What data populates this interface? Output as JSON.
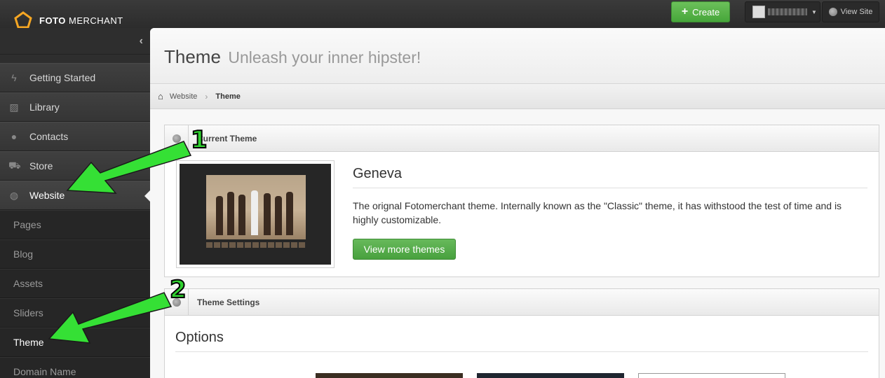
{
  "app": {
    "brand_bold": "FOTO",
    "brand_rest": " MERCHANT",
    "accent": "#f5a623"
  },
  "topbar": {
    "create_label": "Create",
    "view_site_label": "View Site"
  },
  "sidebar": {
    "items": [
      {
        "label": "Getting Started",
        "icon": "bolt-icon"
      },
      {
        "label": "Library",
        "icon": "image-icon"
      },
      {
        "label": "Contacts",
        "icon": "user-icon"
      },
      {
        "label": "Store",
        "icon": "cart-icon"
      },
      {
        "label": "Website",
        "icon": "globe-icon"
      }
    ],
    "sub_items": [
      "Pages",
      "Blog",
      "Assets",
      "Sliders",
      "Theme",
      "Domain Name"
    ]
  },
  "header": {
    "title": "Theme",
    "subtitle": "Unleash your inner hipster!"
  },
  "breadcrumb": {
    "items": [
      "Website",
      "Theme"
    ]
  },
  "current_theme": {
    "panel_title": "Current Theme",
    "name": "Geneva",
    "description": "The orignal Fotomerchant theme. Internally known as the \"Classic\" theme, it has withstood the test of time and is highly customizable.",
    "button_label": "View more themes"
  },
  "theme_settings": {
    "panel_title": "Theme Settings",
    "options_title": "Options"
  },
  "annotations": {
    "step1": "1",
    "step2": "2",
    "color": "#2fd12f"
  }
}
